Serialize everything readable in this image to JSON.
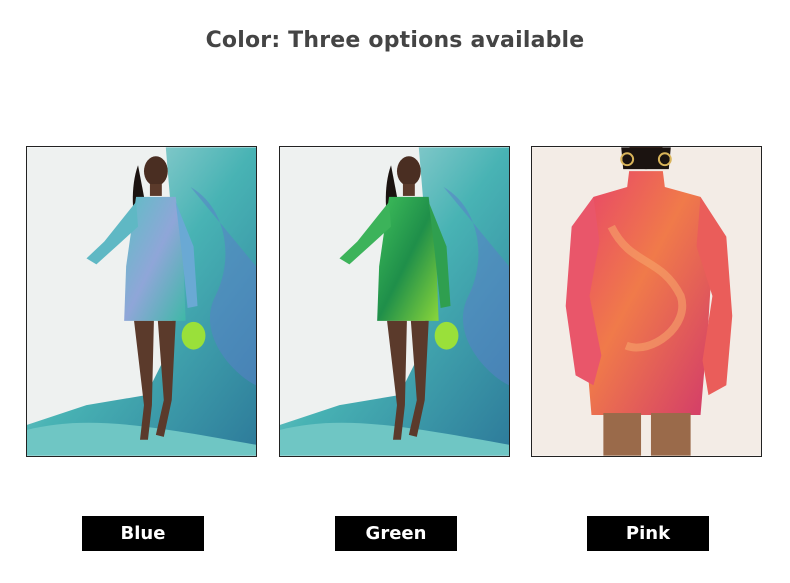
{
  "header": {
    "title": "Color: Three options available"
  },
  "options": [
    {
      "label": "Blue",
      "swatch": "#3fa7b5",
      "icon": "model-photo-blue"
    },
    {
      "label": "Green",
      "swatch": "#3fbf6a",
      "icon": "model-photo-green"
    },
    {
      "label": "Pink",
      "swatch": "#e0506a",
      "icon": "model-photo-pink"
    }
  ]
}
